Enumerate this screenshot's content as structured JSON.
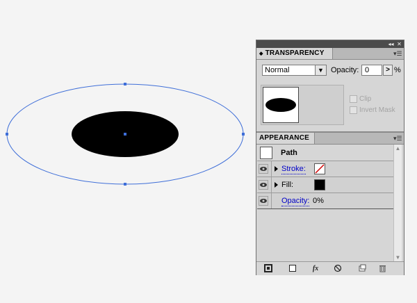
{
  "artwork": {
    "selection_color": "#3e6ed8",
    "fill_color": "#000000"
  },
  "panel_controls": {
    "collapse_icon": "double-arrow-icon",
    "close_icon": "close-icon"
  },
  "transparency": {
    "tab_label": "TRANSPARENCY",
    "blend_mode": "Normal",
    "opacity_label": "Opacity:",
    "opacity_value": "0",
    "opacity_unit": "%",
    "clip_label": "Clip",
    "invert_mask_label": "Invert Mask"
  },
  "appearance": {
    "tab_label": "APPEARANCE",
    "header_label": "Path",
    "rows": [
      {
        "label": "Stroke:",
        "swatch": "none",
        "swatch_color": "#ffffff"
      },
      {
        "label": "Fill:",
        "swatch": "solid",
        "swatch_color": "#000000"
      },
      {
        "label": "Opacity:",
        "value": "0%"
      }
    ],
    "toolbar_icons": [
      "add-stroke-icon",
      "add-fill-icon",
      "fx-icon",
      "clear-icon",
      "duplicate-icon",
      "delete-icon"
    ]
  }
}
